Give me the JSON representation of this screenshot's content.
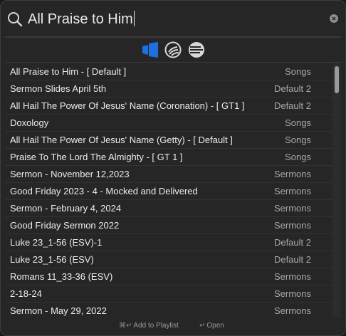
{
  "search": {
    "query": "All Praise to Him"
  },
  "sources": [
    {
      "icon": "songs-library-icon",
      "active": true,
      "color": "#1f6fe0"
    },
    {
      "icon": "slides-library-icon",
      "active": false,
      "color": "#d8d8d8"
    },
    {
      "icon": "sermons-library-icon",
      "active": false,
      "color": "#d8d8d8"
    }
  ],
  "results": [
    {
      "title": "All Praise to Him - [ Default ]",
      "library": "Songs"
    },
    {
      "title": "Sermon Slides April 5th",
      "library": "Default 2"
    },
    {
      "title": "All Hail The Power Of Jesus' Name (Coronation) - [ GT1 ]",
      "library": "Default 2"
    },
    {
      "title": "Doxology",
      "library": "Songs"
    },
    {
      "title": "All Hail The Power Of Jesus' Name (Getty) - [ Default ]",
      "library": "Songs"
    },
    {
      "title": "Praise To The Lord The Almighty - [ GT 1 ]",
      "library": "Songs"
    },
    {
      "title": "Sermon - November 12,2023",
      "library": "Sermons"
    },
    {
      "title": "Good Friday 2023 - 4 - Mocked and Delivered",
      "library": "Sermons"
    },
    {
      "title": "Sermon - February 4, 2024",
      "library": "Sermons"
    },
    {
      "title": "Good Friday Sermon 2022",
      "library": "Sermons"
    },
    {
      "title": "Luke 23_1-56 (ESV)-1",
      "library": "Default 2"
    },
    {
      "title": "Luke 23_1-56 (ESV)",
      "library": "Default 2"
    },
    {
      "title": "Romans 11_33-36 (ESV)",
      "library": "Sermons"
    },
    {
      "title": "2-18-24",
      "library": "Sermons"
    },
    {
      "title": "Sermon - May 29, 2022",
      "library": "Sermons"
    }
  ],
  "footer": {
    "add_shortcut": "⌘↵",
    "add_label": "Add to Playlist",
    "open_shortcut": "↵",
    "open_label": "Open"
  },
  "colors": {
    "accent": "#1f6fe0",
    "background": "#262626"
  }
}
